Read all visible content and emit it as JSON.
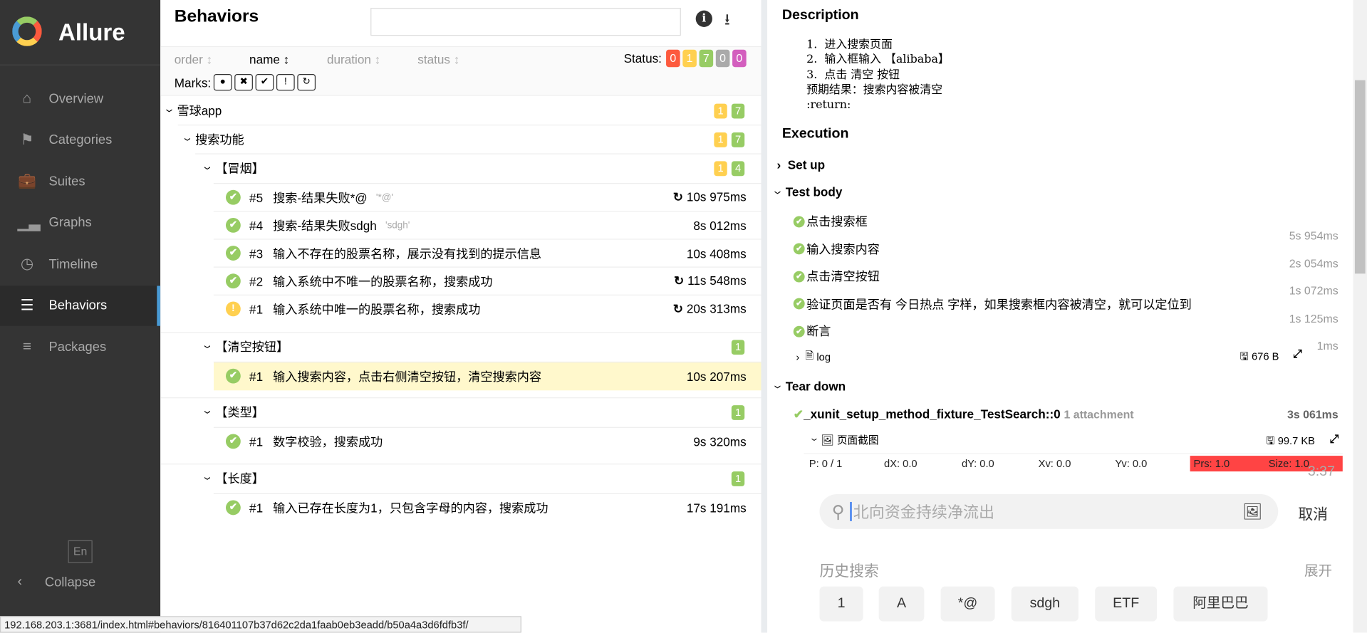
{
  "app": {
    "name": "Allure"
  },
  "sidebar": {
    "items": [
      {
        "label": "Overview",
        "icon": "home-icon"
      },
      {
        "label": "Categories",
        "icon": "flag-icon"
      },
      {
        "label": "Suites",
        "icon": "briefcase-icon"
      },
      {
        "label": "Graphs",
        "icon": "bar-chart-icon"
      },
      {
        "label": "Timeline",
        "icon": "clock-icon"
      },
      {
        "label": "Behaviors",
        "icon": "list-icon",
        "active": true
      },
      {
        "label": "Packages",
        "icon": "align-left-icon"
      }
    ],
    "lang": "En",
    "collapse": "Collapse"
  },
  "left": {
    "title": "Behaviors",
    "search_value": "",
    "sort": [
      "order",
      "name",
      "duration",
      "status"
    ],
    "status_label": "Status:",
    "status_counts": [
      {
        "v": "0",
        "color": "#fd5a3e"
      },
      {
        "v": "1",
        "color": "#ffd050"
      },
      {
        "v": "7",
        "color": "#97cc64"
      },
      {
        "v": "0",
        "color": "#aaaaaa"
      },
      {
        "v": "0",
        "color": "#d35ebe"
      }
    ],
    "marks_label": "Marks:"
  },
  "tree": {
    "root": {
      "name": "雪球app",
      "counts": [
        "1",
        "7"
      ]
    },
    "feature": {
      "name": "搜索功能",
      "counts": [
        "1",
        "7"
      ]
    },
    "groups": [
      {
        "name": "【冒烟】",
        "counts": [
          "1",
          "4"
        ],
        "tests": [
          {
            "num": "#5",
            "name": "搜索-结果失败*@",
            "param": "'*@'",
            "dur": "10s 975ms",
            "retry": true,
            "status": "passed"
          },
          {
            "num": "#4",
            "name": "搜索-结果失败sdgh",
            "param": "'sdgh'",
            "dur": "8s 012ms",
            "retry": false,
            "status": "passed"
          },
          {
            "num": "#3",
            "name": "输入不存在的股票名称，展示没有找到的提示信息",
            "param": "",
            "dur": "10s 408ms",
            "retry": false,
            "status": "passed"
          },
          {
            "num": "#2",
            "name": "输入系统中不唯一的股票名称，搜索成功",
            "param": "",
            "dur": "11s 548ms",
            "retry": true,
            "status": "passed"
          },
          {
            "num": "#1",
            "name": "输入系统中唯一的股票名称，搜索成功",
            "param": "",
            "dur": "20s 313ms",
            "retry": true,
            "status": "broken"
          }
        ]
      },
      {
        "name": "【清空按钮】",
        "counts": [
          "1"
        ],
        "tests": [
          {
            "num": "#1",
            "name": "输入搜索内容，点击右侧清空按钮，清空搜索内容",
            "param": "",
            "dur": "10s 207ms",
            "status": "passed",
            "selected": true
          }
        ]
      },
      {
        "name": "【类型】",
        "counts": [
          "1"
        ],
        "tests": [
          {
            "num": "#1",
            "name": "数字校验，搜索成功",
            "param": "",
            "dur": "9s 320ms",
            "status": "passed"
          }
        ]
      },
      {
        "name": "【长度】",
        "counts": [
          "1"
        ],
        "tests": [
          {
            "num": "#1",
            "name": "输入已存在长度为1，只包含字母的内容，搜索成功",
            "param": "",
            "dur": "17s 191ms",
            "status": "passed"
          }
        ]
      }
    ]
  },
  "detail": {
    "description_title": "Description",
    "description": "1.  进入搜索页面\n2.  输入框输入 【alibaba】\n3.  点击 清空 按钮\n预期结果：搜索内容被清空\n:return:",
    "execution_title": "Execution",
    "setup": "Set up",
    "testbody": "Test body",
    "teardown": "Tear down",
    "steps": [
      {
        "name": "点击搜索框",
        "dur": "5s 954ms"
      },
      {
        "name": "输入搜索内容",
        "dur": "2s 054ms"
      },
      {
        "name": "点击清空按钮",
        "dur": "1s 072ms"
      },
      {
        "name": "验证页面是否有 今日热点 字样，如果搜索框内容被清空，就可以定位到",
        "dur": "1s 125ms"
      },
      {
        "name": "断言",
        "dur": "1ms"
      }
    ],
    "log": {
      "name": "log",
      "size": "676 B"
    },
    "fixture": {
      "name": "_xunit_setup_method_fixture_TestSearch::0",
      "attach": "1 attachment",
      "dur": "3s 061ms"
    },
    "attachment": {
      "name": "页面截图",
      "size": "99.7 KB"
    },
    "screenshot": {
      "p": "P: 0 / 1",
      "dx": "dX: 0.0",
      "dy": "dY: 0.0",
      "xv": "Xv: 0.0",
      "yv": "Yv: 0.0",
      "prs": "Prs: 1.0",
      "size": "Size: 1.0",
      "time": "3:37",
      "placeholder": "北向资金持续净流出",
      "cancel": "取消",
      "history": "历史搜索",
      "expand": "展开",
      "chips": [
        "1",
        "A",
        "*@",
        "sdgh",
        "ETF",
        "阿里巴巴"
      ]
    }
  },
  "statusbar": {
    "url": "192.168.203.1:3681/index.html#behaviors/816401107b37d62c2da1faab0eb3eadd/b50a4a3d6fdfb3f/"
  }
}
